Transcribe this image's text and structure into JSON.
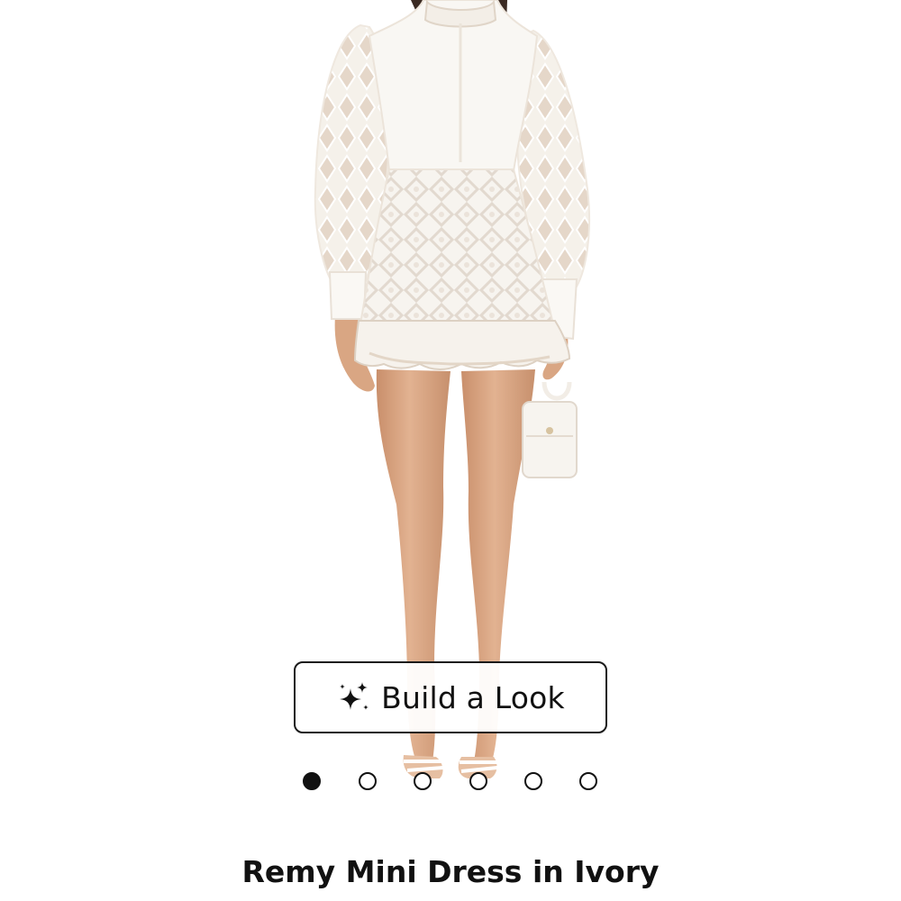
{
  "product": {
    "title": "Remy Mini Dress in Ivory",
    "image_alt": "Remy Mini Dress in Ivory"
  },
  "actions": {
    "build_look_label": "Build a Look",
    "build_look_icon": "sparkle-icon"
  },
  "carousel": {
    "total": 6,
    "active_index": 0
  },
  "colors": {
    "text": "#111111",
    "background": "#ffffff",
    "dress": "#f8f6f1",
    "skin": "#dca986"
  }
}
